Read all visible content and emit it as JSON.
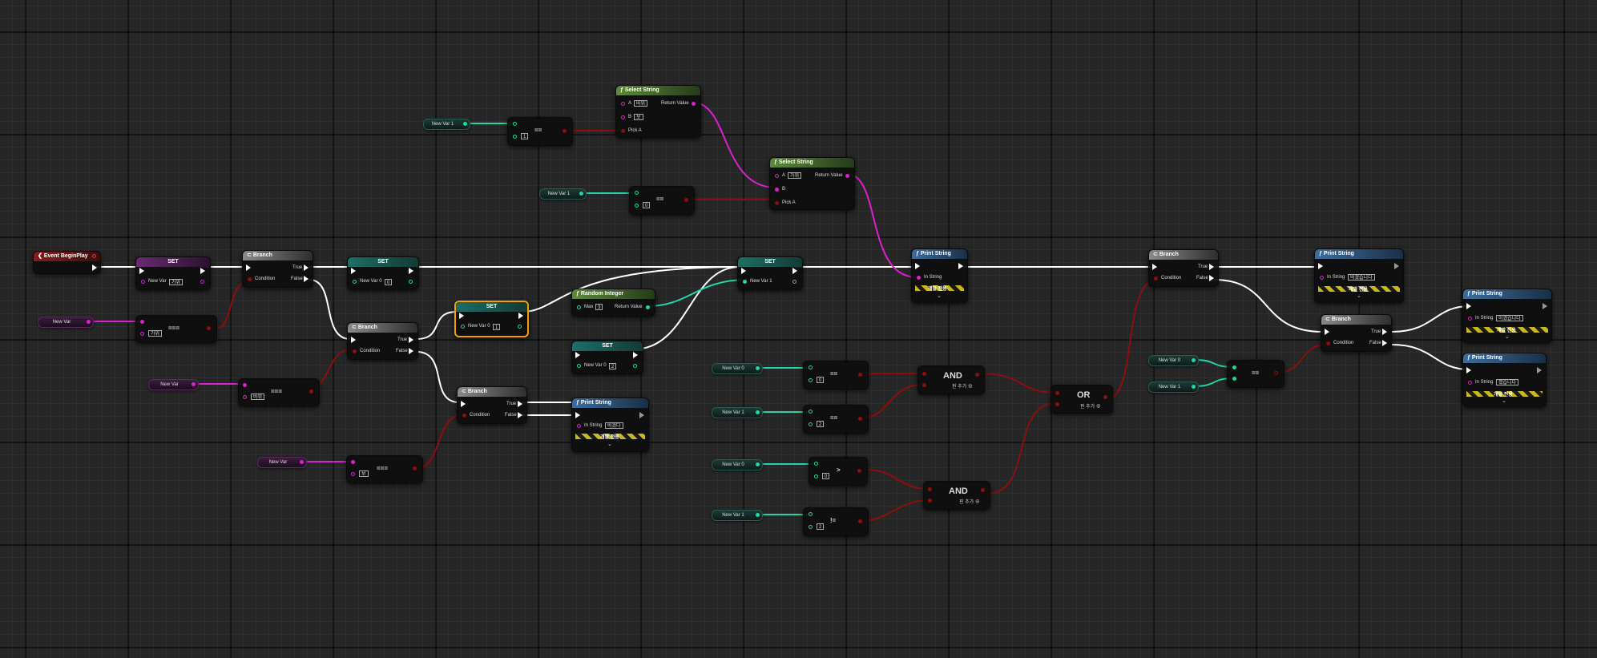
{
  "event_node": {
    "title": "Event BeginPlay"
  },
  "nodes": {
    "set1": {
      "title": "SET",
      "pin_label": "New Var",
      "value": "가위"
    },
    "branch1": {
      "title": "Branch",
      "condition": "Condition",
      "true": "True",
      "false": "False"
    },
    "set2": {
      "title": "SET",
      "pin_label": "New Var 0",
      "value": "0"
    },
    "branch2": {
      "title": "Branch",
      "condition": "Condition",
      "true": "True",
      "false": "False"
    },
    "set_selected": {
      "title": "SET",
      "pin_label": "New Var 0",
      "value": "1"
    },
    "branch3": {
      "title": "Branch",
      "condition": "Condition",
      "true": "True",
      "false": "False"
    },
    "random_integer": {
      "title": "Random Integer",
      "max_label": "Max",
      "max_value": "3",
      "return_label": "Return Value"
    },
    "set3": {
      "title": "SET",
      "pin_label": "New Var 0",
      "value": "2"
    },
    "print_mid": {
      "title": "Print String",
      "instring": "In String",
      "value": "비겼다",
      "dev": "개발 전용"
    },
    "select1": {
      "title": "Select String",
      "a_label": "A",
      "a_value": "바위",
      "b_label": "B",
      "b_value": "보",
      "pick_label": "Pick A",
      "return_label": "Return Value"
    },
    "select2": {
      "title": "Select String",
      "a_label": "A",
      "a_value": "가위",
      "b_label": "B",
      "pick_label": "Pick A",
      "return_label": "Return Value"
    },
    "set4": {
      "title": "SET",
      "pin_label": "New Var 1"
    },
    "print_main": {
      "title": "Print String",
      "instring": "In String",
      "dev": "개발 전용"
    },
    "branch4": {
      "title": "Branch",
      "condition": "Condition",
      "true": "True",
      "false": "False"
    },
    "print_tie": {
      "title": "Print String",
      "instring": "In String",
      "value": "비겼습니다",
      "dev": "개발 전용"
    },
    "branch5": {
      "title": "Branch",
      "condition": "Condition",
      "true": "True",
      "false": "False"
    },
    "print_lose": {
      "title": "Print String",
      "instring": "In String",
      "value": "이겼습니다",
      "dev": "개발 전용"
    },
    "print_win": {
      "title": "Print String",
      "instring": "In String",
      "value": "졌습니다",
      "dev": "개발 전용"
    },
    "eq1": {
      "op": "===",
      "value": "가위"
    },
    "eq2": {
      "op": "===",
      "value": "바위"
    },
    "eq3": {
      "op": "===",
      "value": "보"
    },
    "eq_int1": {
      "op": "==",
      "value": "1"
    },
    "eq_int0": {
      "op": "==",
      "value": "0"
    },
    "eq_a": {
      "op": "==",
      "value": "0"
    },
    "eq_b": {
      "op": "==",
      "value": "2"
    },
    "gt": {
      "op": ">",
      "value": "0"
    },
    "neq": {
      "op": "!=",
      "value": "2"
    },
    "eq_final": {
      "op": "=="
    },
    "and1": {
      "op": "AND",
      "add": "핀 추가"
    },
    "and2": {
      "op": "AND",
      "add": "핀 추가"
    },
    "or1": {
      "op": "OR",
      "add": "핀 추가"
    }
  },
  "variables": {
    "nv_a": "New Var",
    "nv_b": "New Var",
    "nv_c": "New Var",
    "nv1_top": "New Var 1",
    "nv1_mid": "New Var 1",
    "nv0_a": "New Var 0",
    "nv1_a": "New Var 1",
    "nv0_b": "New Var 0",
    "nv1_b": "New Var 1",
    "nv0_r": "New Var 0",
    "nv1_r": "New Var 1"
  },
  "colors": {
    "exec": "#ffffff",
    "string": "#e01fcf",
    "integer": "#1ed6a8",
    "bool": "#8c0f0f",
    "selected": "#f0a000"
  }
}
